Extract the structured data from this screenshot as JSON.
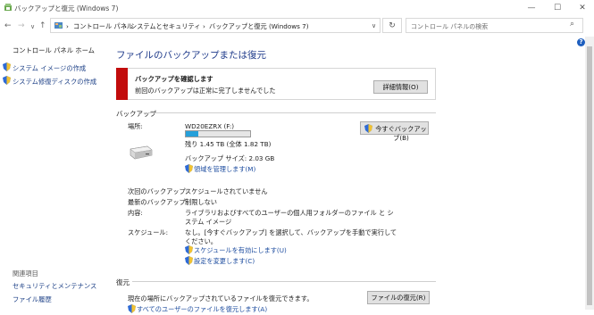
{
  "window": {
    "title": "バックアップと復元 (Windows 7)",
    "minimize": "—",
    "maximize": "☐",
    "close": "✕"
  },
  "nav": {
    "back": "←",
    "forward": "→",
    "recent": "∨",
    "up": "↑"
  },
  "breadcrumb": {
    "items": [
      "コントロール パネル",
      "システムとセキュリティ",
      "バックアップと復元 (Windows 7)"
    ],
    "sep": "›",
    "dropdown": "∨",
    "refresh": "↻"
  },
  "search": {
    "placeholder": "コントロール パネルの検索",
    "icon": "⌕"
  },
  "help": "?",
  "sidebar": {
    "home": "コントロール パネル ホーム",
    "items": [
      "システム イメージの作成",
      "システム修復ディスクの作成"
    ],
    "related_heading": "関連項目",
    "related": [
      "セキュリティとメンテナンス",
      "ファイル履歴"
    ]
  },
  "main": {
    "heading": "ファイルのバックアップまたは復元",
    "alert": {
      "title": "バックアップを確認します",
      "message": "前回のバックアップは正常に完了しませんでした",
      "button": "詳細情報(O)",
      "color": "#c20c0c"
    },
    "backup": {
      "section": "バックアップ",
      "location_label": "場所:",
      "drive": "WD20EZRX (F:)",
      "usage_fraction": 0.19,
      "remaining": "残り 1.45 TB (全体 1.82 TB)",
      "size": "バックアップ サイズ: 2.03 GB",
      "manage_link": "領域を管理します(M)",
      "backup_now_button": "今すぐバックアップ(B)",
      "next_label": "次回のバックアップ:",
      "next_value": "スケジュールされていません",
      "last_label": "最新のバックアップ:",
      "last_value": "制限しない",
      "contents_label": "内容:",
      "contents_value_1": "ライブラリおよびすべてのユーザーの個人用フォルダーのファイル と シ",
      "contents_value_2": "ステム イメージ",
      "schedule_label": "スケジュール:",
      "schedule_value_1": "なし。[今すぐバックアップ] を選択して、バックアップを手動で実行して",
      "schedule_value_2": "ください。",
      "enable_schedule_link": "スケジュールを有効にします(U)",
      "change_settings_link": "設定を変更します(C)"
    },
    "restore": {
      "section": "復元",
      "message": "現在の場所にバックアップされているファイルを復元できます。",
      "button": "ファイルの復元(R)",
      "all_users_link": "すべてのユーザーのファイルを復元します(A)"
    }
  }
}
